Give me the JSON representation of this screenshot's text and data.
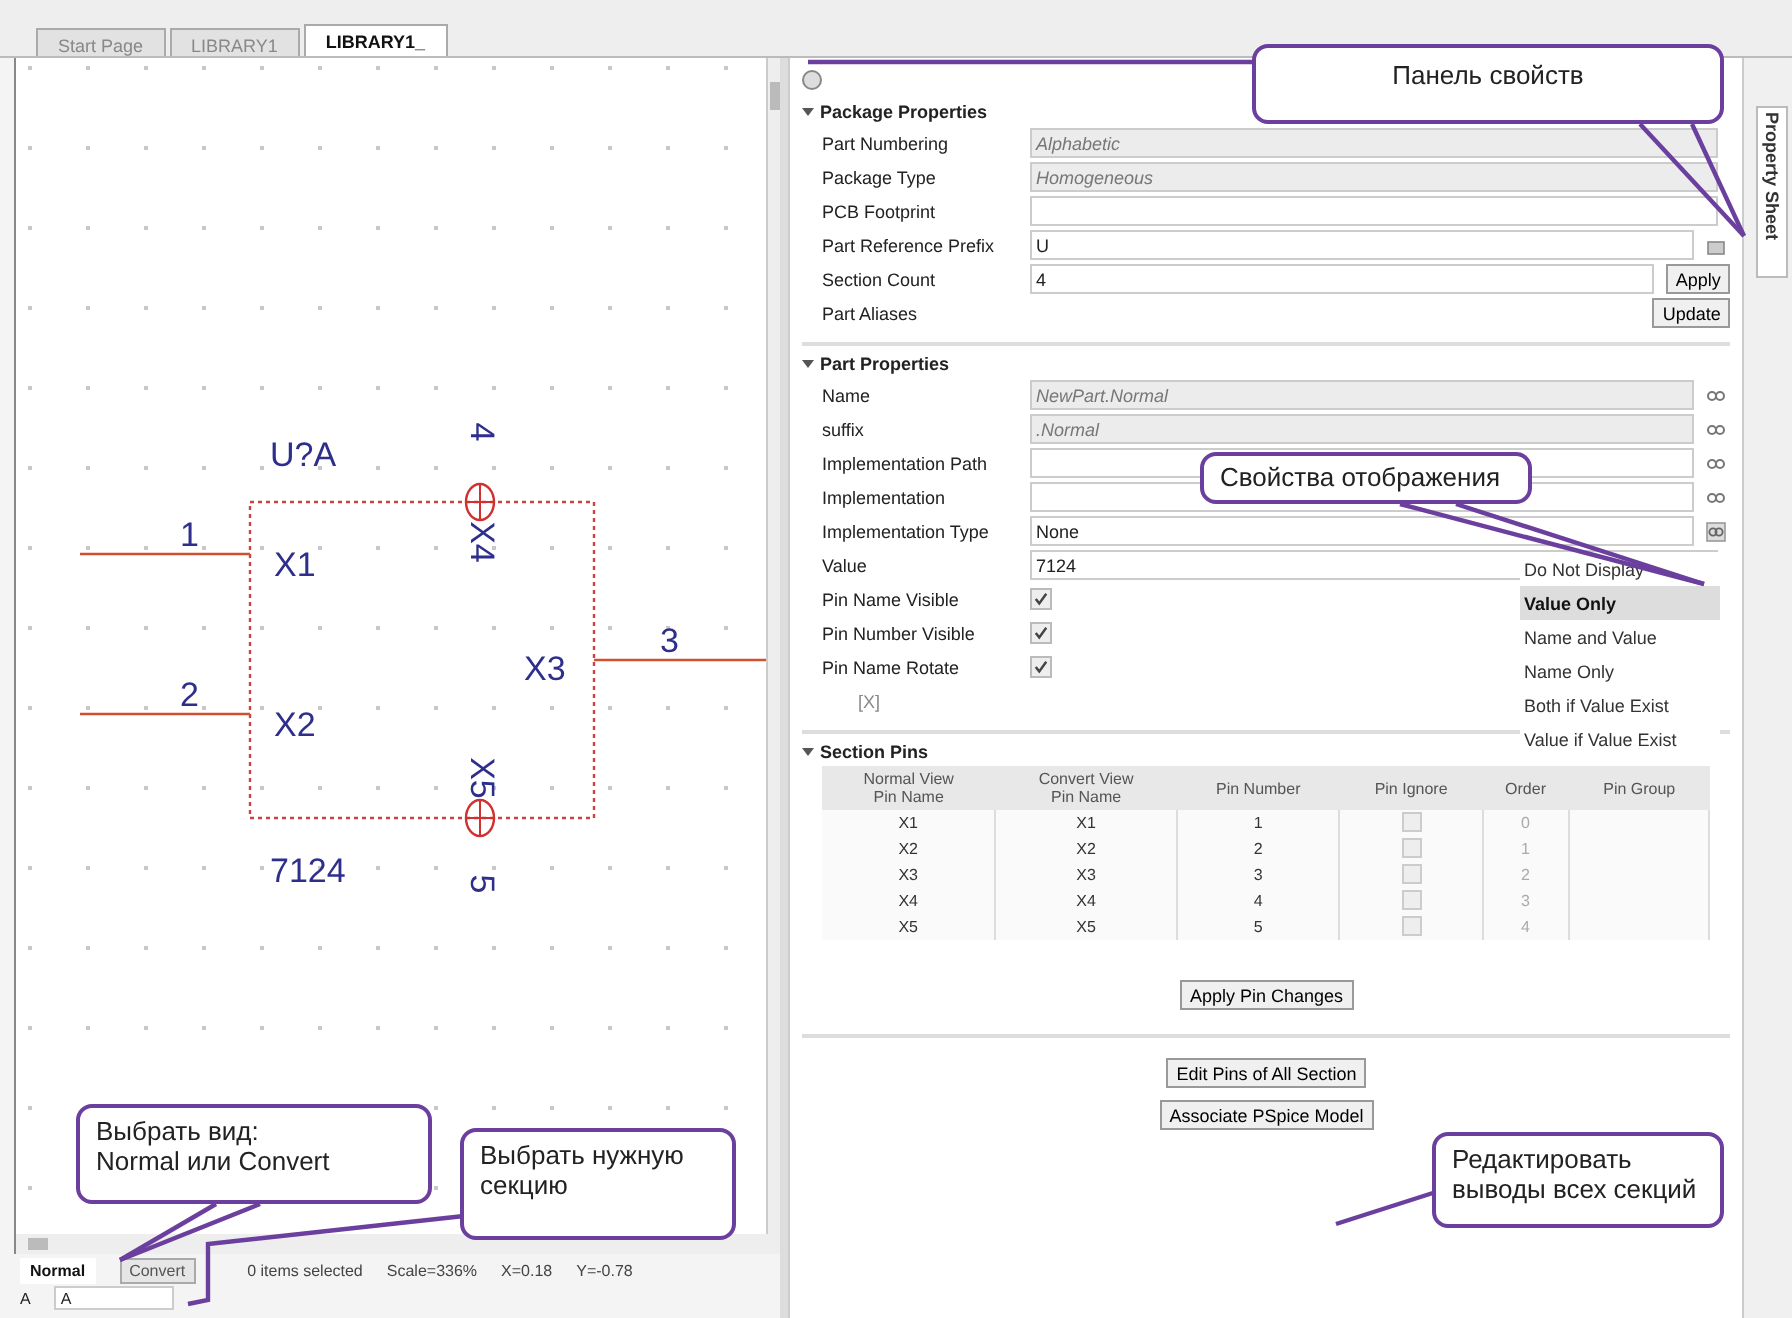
{
  "tabs": [
    {
      "label": "Start Page",
      "selected": false
    },
    {
      "label": "LIBRARY1",
      "selected": false
    },
    {
      "label": "LIBRARY1_",
      "selected": true
    }
  ],
  "schematic": {
    "reference": "U?A",
    "value": "7124",
    "pins": [
      {
        "number": "1",
        "name": "X1"
      },
      {
        "number": "2",
        "name": "X2"
      },
      {
        "number": "3",
        "name": "X3"
      },
      {
        "number": "4",
        "name": "X4"
      },
      {
        "number": "5",
        "name": "X5"
      }
    ]
  },
  "status_bar": {
    "view_tabs": [
      {
        "label": "Normal",
        "selected": true
      },
      {
        "label": "Convert",
        "selected": false
      }
    ],
    "selection": "0 items selected",
    "scale": "Scale=336%",
    "x": "X=0.18",
    "y": "Y=-0.78",
    "section_label": "A",
    "section_value": "A"
  },
  "property_sheet": {
    "tab_label": "Property Sheet",
    "sections": [
      {
        "title": "Package Properties",
        "rows": [
          {
            "kind": "field",
            "label": "Part Numbering",
            "value": "Alphabetic",
            "disabled": true
          },
          {
            "kind": "field",
            "label": "Package Type",
            "value": "Homogeneous",
            "disabled": true
          },
          {
            "kind": "field",
            "label": "PCB Footprint",
            "disabled": false
          },
          {
            "kind": "browse-field",
            "label": "Part Reference Prefix",
            "value": "U",
            "disabled": false
          },
          {
            "kind": "field",
            "label": "Section Count",
            "value": "4",
            "disabled": false,
            "button": "Apply"
          },
          {
            "kind": "label",
            "label": "Part Aliases",
            "button": "Update"
          }
        ]
      },
      {
        "title": "Part Properties",
        "rows": [
          {
            "kind": "display-field",
            "label": "Name",
            "value": "NewPart.Normal",
            "disabled": true
          },
          {
            "kind": "display-field",
            "label": "suffix",
            "value": ".Normal",
            "disabled": true
          },
          {
            "kind": "display-field",
            "label": "Implementation Path",
            "disabled": false
          },
          {
            "kind": "display-field",
            "label": "Implementation",
            "disabled": false
          },
          {
            "kind": "menu-field",
            "label": "Implementation Type",
            "value": "None",
            "disabled": false
          },
          {
            "kind": "field",
            "label": "Value",
            "value": "7124",
            "disabled": false
          },
          {
            "kind": "checkbox",
            "label": "Pin Name Visible",
            "checked": true
          },
          {
            "kind": "checkbox",
            "label": "Pin Number Visible",
            "checked": true
          },
          {
            "kind": "checkbox",
            "label": "Pin Name Rotate",
            "checked": true
          },
          {
            "kind": "note",
            "label": "[X]"
          }
        ],
        "display_options": [
          {
            "label": "Do Not Display",
            "selected": false
          },
          {
            "label": "Value Only",
            "selected": true
          },
          {
            "label": "Name and Value",
            "selected": false
          },
          {
            "label": "Name Only",
            "selected": false
          },
          {
            "label": "Both if Value Exist",
            "selected": false
          },
          {
            "label": "Value if Value Exist",
            "selected": false
          }
        ]
      },
      {
        "title": "Section Pins",
        "table": {
          "columns": [
            "Normal View\nPin Name",
            "Convert View\nPin Name",
            "Pin Number",
            "Pin Ignore",
            "Order",
            "Pin Group"
          ],
          "rows": [
            {
              "normal": "X1",
              "convert": "X1",
              "number": "1",
              "ignore": false,
              "order": "0"
            },
            {
              "normal": "X2",
              "convert": "X2",
              "number": "2",
              "ignore": false,
              "order": "1"
            },
            {
              "normal": "X3",
              "convert": "X3",
              "number": "3",
              "ignore": false,
              "order": "2"
            },
            {
              "normal": "X4",
              "convert": "X4",
              "number": "4",
              "ignore": false,
              "order": "3"
            },
            {
              "normal": "X5",
              "convert": "X5",
              "number": "5",
              "ignore": false,
              "order": "4"
            }
          ]
        },
        "buttons": [
          "Apply Pin Changes"
        ]
      }
    ],
    "buttons": [
      "Edit Pins of All Section",
      "Associate PSpice Model"
    ]
  },
  "callouts": [
    {
      "text": "Панель свойств"
    },
    {
      "text": "Свойства отображения"
    },
    {
      "text": "Выбрать вид:\nNormal или Convert"
    },
    {
      "text": "Выбрать нужную\nсекцию"
    },
    {
      "text": "Редактировать\nвыводы всех секций"
    }
  ]
}
